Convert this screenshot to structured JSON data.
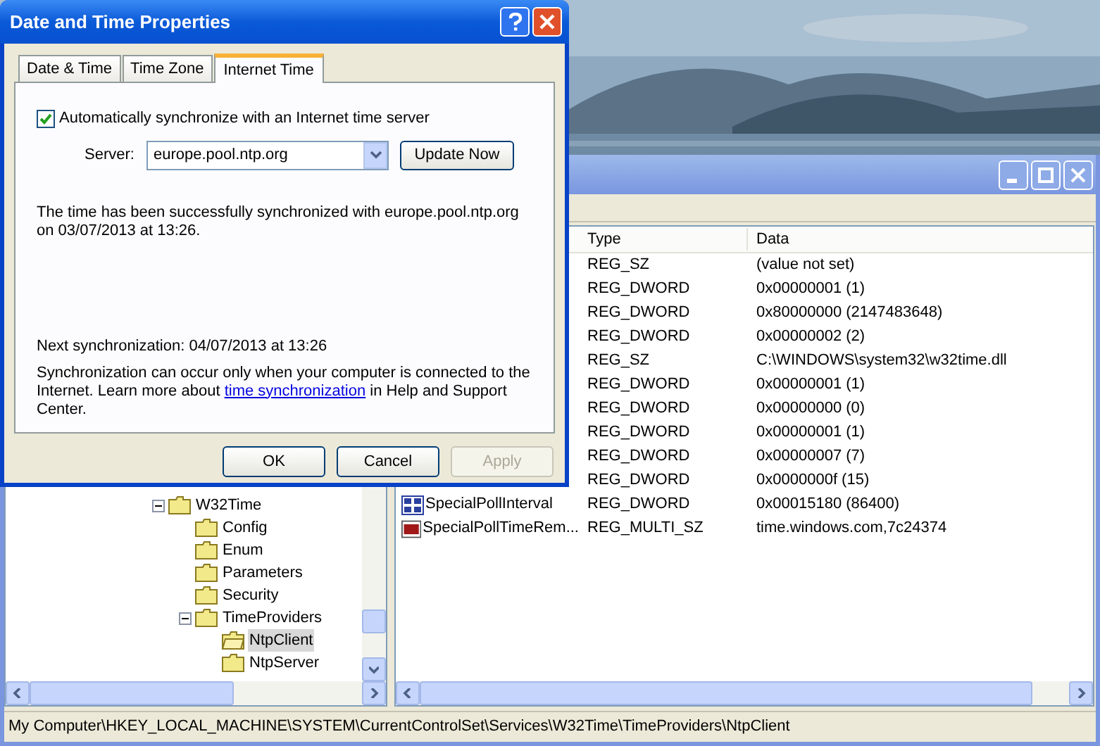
{
  "dialog": {
    "title": "Date and Time Properties",
    "tabs": [
      {
        "label": "Date & Time",
        "selected": false
      },
      {
        "label": "Time Zone",
        "selected": false
      },
      {
        "label": "Internet Time",
        "selected": true
      }
    ],
    "auto_sync": {
      "label": "Automatically synchronize with an Internet time server",
      "checked": true
    },
    "server": {
      "label": "Server:",
      "value": "europe.pool.ntp.org"
    },
    "update_button": "Update Now",
    "status_text": "The time has been successfully synchronized with europe.pool.ntp.org on 03/07/2013 at 13:26.",
    "next_sync": "Next synchronization: 04/07/2013 at 13:26",
    "info": {
      "before": "Synchronization can occur only when your computer is connected to the Internet.  Learn more about",
      "link": "time synchronization",
      "after": "in Help and Support Center."
    },
    "buttons": [
      {
        "label": "OK",
        "disabled": false
      },
      {
        "label": "Cancel",
        "disabled": false
      },
      {
        "label": "Apply",
        "disabled": true
      }
    ]
  },
  "registry": {
    "tree": [
      {
        "label": "W32Time",
        "expanded": true,
        "selected": false,
        "children": [
          {
            "label": "Config",
            "selected": false
          },
          {
            "label": "Enum",
            "selected": false
          },
          {
            "label": "Parameters",
            "selected": false
          },
          {
            "label": "Security",
            "selected": false
          },
          {
            "label": "TimeProviders",
            "expanded": true,
            "selected": false,
            "children": [
              {
                "label": "NtpClient",
                "selected": true
              },
              {
                "label": "NtpServer",
                "selected": false
              }
            ]
          }
        ]
      }
    ],
    "columns": [
      "Type",
      "Data"
    ],
    "rows": [
      {
        "type": "REG_SZ",
        "data": "(value not set)"
      },
      {
        "type": "REG_DWORD",
        "data": "0x00000001 (1)"
      },
      {
        "type": "REG_DWORD",
        "data": "0x80000000 (2147483648)"
      },
      {
        "type": "REG_DWORD",
        "data": "0x00000002 (2)"
      },
      {
        "type": "REG_SZ",
        "data": "C:\\WINDOWS\\system32\\w32time.dll"
      },
      {
        "type": "REG_DWORD",
        "data": "0x00000001 (1)"
      },
      {
        "type": "REG_DWORD",
        "data": "0x00000000 (0)"
      },
      {
        "type": "REG_DWORD",
        "data": "0x00000001 (1)"
      },
      {
        "type": "REG_DWORD",
        "data": "0x00000007 (7)"
      },
      {
        "type": "REG_DWORD",
        "data": "0x0000000f (15)"
      },
      {
        "name": "SpecialPollInterval",
        "kind": "binary",
        "type": "REG_DWORD",
        "data": "0x00015180 (86400)"
      },
      {
        "name": "SpecialPollTimeRem...",
        "kind": "string",
        "type": "REG_MULTI_SZ",
        "data": "time.windows.com,7c24374"
      }
    ],
    "status_bar": "My Computer\\HKEY_LOCAL_MACHINE\\SYSTEM\\CurrentControlSet\\Services\\W32Time\\TimeProviders\\NtpClient"
  }
}
